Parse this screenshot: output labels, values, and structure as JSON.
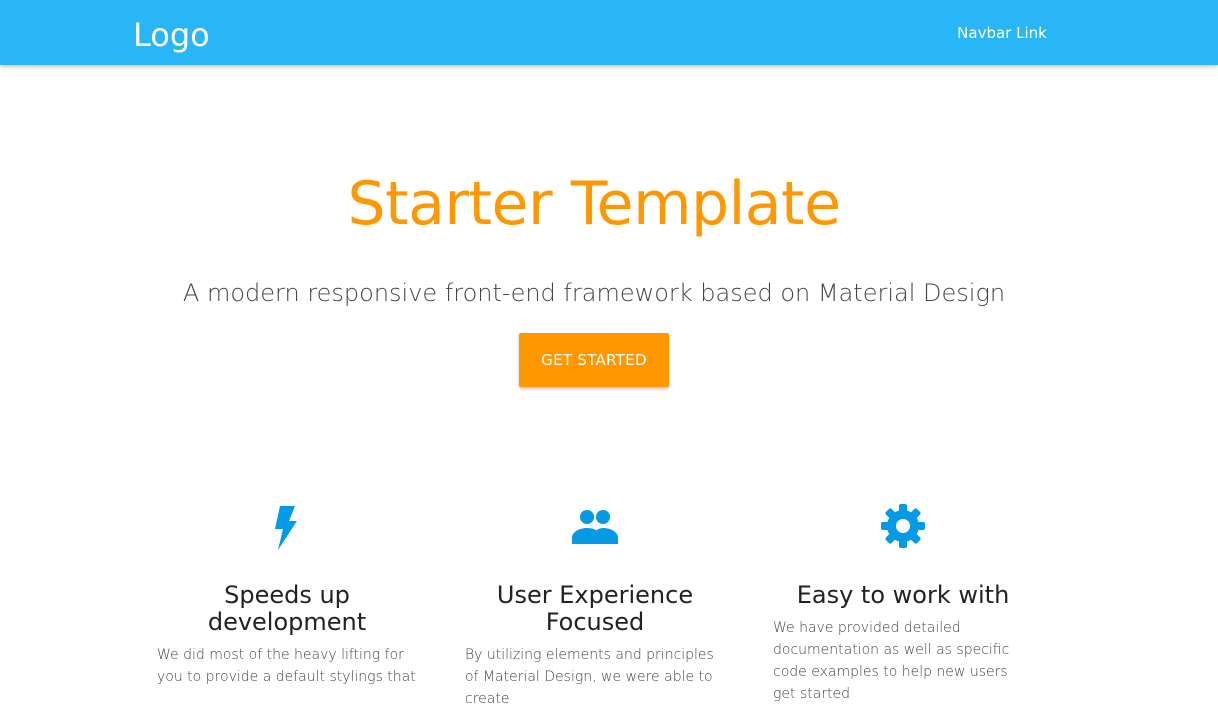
{
  "navbar": {
    "logo": "Logo",
    "link": "Navbar Link"
  },
  "hero": {
    "title": "Starter Template",
    "subtitle": "A modern responsive front-end framework based on Material Design",
    "button": "GET STARTED"
  },
  "features": [
    {
      "icon": "flash-icon",
      "title_line1": "Speeds up",
      "title_line2": "development",
      "text": "We did most of the heavy lifting for you to provide a default stylings that"
    },
    {
      "icon": "group-icon",
      "title_line1": "User Experience",
      "title_line2": "Focused",
      "text": "By utilizing elements and principles of Material Design, we were able to create"
    },
    {
      "icon": "settings-icon",
      "title_line1": "Easy to work with",
      "title_line2": "",
      "text": "We have provided detailed documentation as well as specific code examples to help new users get started"
    }
  ],
  "colors": {
    "navbar": "#29b6f6",
    "accent": "#ff9800",
    "icon": "#039be5"
  }
}
